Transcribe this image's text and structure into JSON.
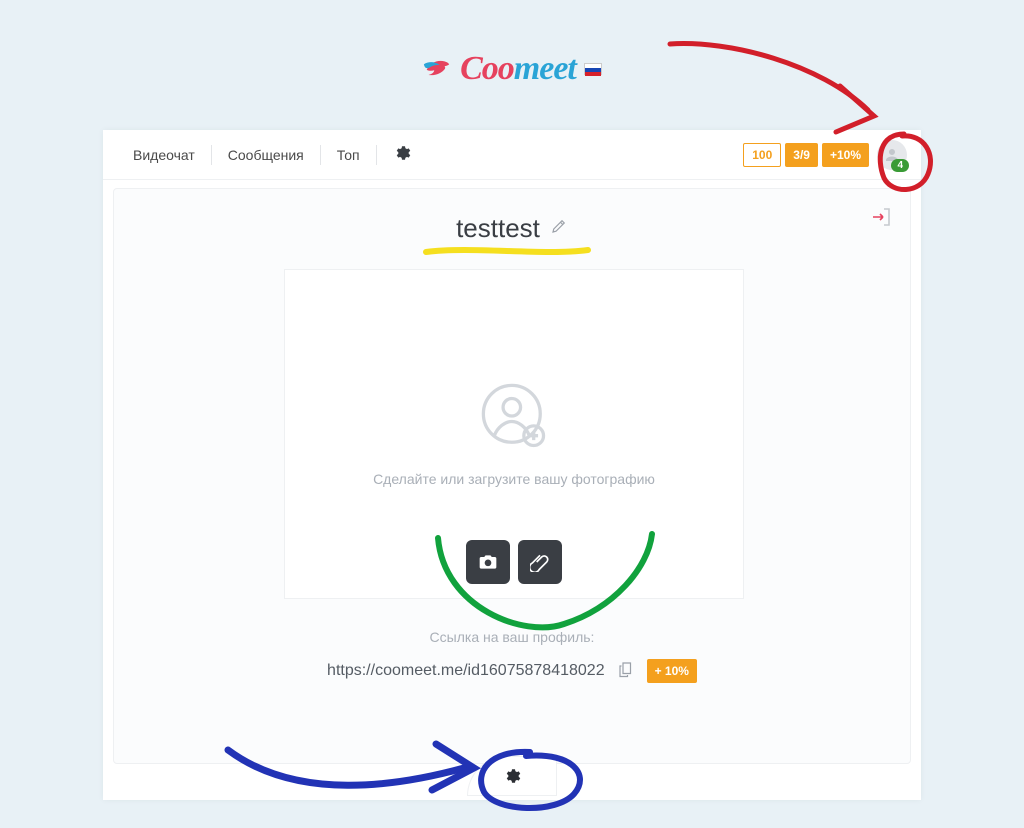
{
  "brand": {
    "name_part1": "Coo",
    "name_part2": "meet",
    "flag": "ru"
  },
  "nav": {
    "items": [
      {
        "label": "Видеочат"
      },
      {
        "label": "Сообщения"
      },
      {
        "label": "Топ"
      }
    ],
    "badges": {
      "minutes": "100",
      "ratio": "3/9",
      "bonus": "+10%"
    },
    "avatar_count": "4"
  },
  "profile": {
    "username": "testtest",
    "photo_caption": "Сделайте или загрузите вашу фотографию",
    "link_caption": "Ссылка на ваш профиль:",
    "link_url": "https://coomeet.me/id16075878418022",
    "bonus_label": "+ 10%"
  }
}
